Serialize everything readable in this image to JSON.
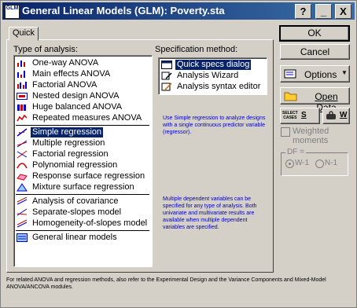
{
  "window": {
    "title": "General Linear Models (GLM): Poverty.sta",
    "app_icon_text": "GLM"
  },
  "title_buttons": {
    "help": "?",
    "minimize": "_",
    "close": "X"
  },
  "tab": {
    "label": "Quick"
  },
  "analysis": {
    "label": "Type of analysis:",
    "items": [
      {
        "label": "One-way ANOVA",
        "icon": "oneway-anova-icon"
      },
      {
        "label": "Main effects ANOVA",
        "icon": "main-effects-icon"
      },
      {
        "label": "Factorial ANOVA",
        "icon": "factorial-anova-icon"
      },
      {
        "label": "Nested design ANOVA",
        "icon": "nested-design-icon"
      },
      {
        "label": "Huge balanced ANOVA",
        "icon": "huge-balanced-icon"
      },
      {
        "label": "Repeated measures ANOVA",
        "icon": "repeated-measures-icon"
      },
      {
        "label": "Simple regression",
        "icon": "simple-regression-icon"
      },
      {
        "label": "Multiple regression",
        "icon": "multiple-regression-icon"
      },
      {
        "label": "Factorial regression",
        "icon": "factorial-regression-icon"
      },
      {
        "label": "Polynomial regression",
        "icon": "polynomial-regression-icon"
      },
      {
        "label": "Response surface regression",
        "icon": "response-surface-icon"
      },
      {
        "label": "Mixture surface regression",
        "icon": "mixture-surface-icon"
      },
      {
        "label": "Analysis of covariance",
        "icon": "covariance-icon"
      },
      {
        "label": "Separate-slopes model",
        "icon": "separate-slopes-icon"
      },
      {
        "label": "Homogeneity-of-slopes model",
        "icon": "homogeneity-slopes-icon"
      },
      {
        "label": "General linear models",
        "icon": "general-linear-icon"
      }
    ],
    "selected": "Simple regression"
  },
  "spec": {
    "label": "Specification method:",
    "items": [
      {
        "label": "Quick specs dialog"
      },
      {
        "label": "Analysis Wizard"
      },
      {
        "label": "Analysis syntax editor"
      }
    ]
  },
  "info": {
    "simple": "Use Simple regression to analyze designs with a single continuous predictor variable (regressor).",
    "multiple": "Multiple dependent variables can be specified for any type of analysis. Both univariate and multivariate results are available when multiple dependent variables are specified."
  },
  "buttons": {
    "ok": "OK",
    "cancel": "Cancel",
    "options": "Options",
    "open_data": "Open Data",
    "select_cases_line1": "SELECT",
    "select_cases_line2": "CASES",
    "s": "S",
    "w": "W"
  },
  "weighted": {
    "label": "Weighted moments"
  },
  "df": {
    "label": "DF =",
    "w1": "W-1",
    "n1": "N-1"
  },
  "footer": "For related ANOVA and regression methods, also refer to the Experimental Design and the Variance Components and Mixed-Model ANOVA/ANCOVA modules."
}
